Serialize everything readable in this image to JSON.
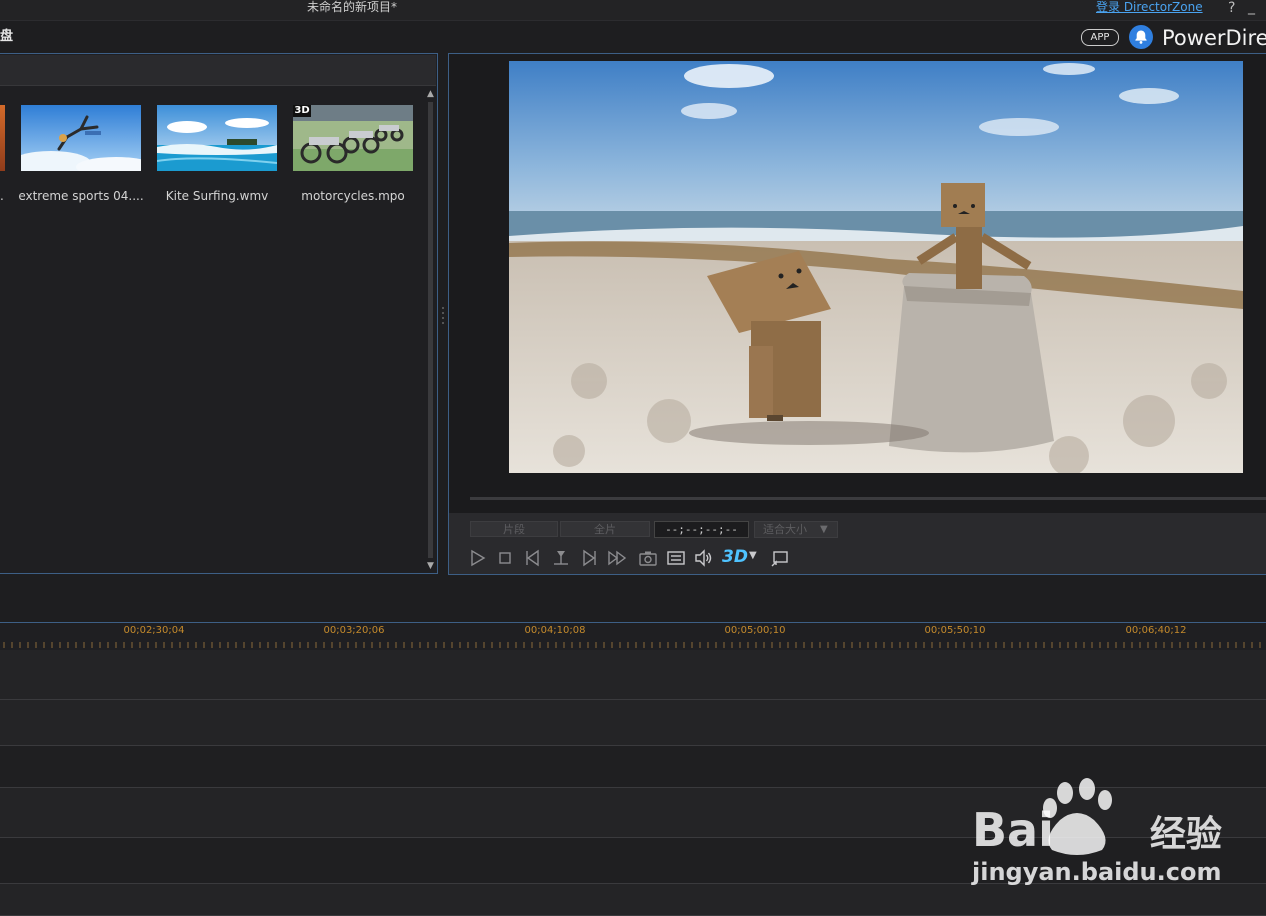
{
  "window": {
    "title": "未命名的新项目*",
    "login_link": "登录 DirectorZone",
    "help": "?",
    "minimize": "_"
  },
  "header": {
    "left_label": "盘",
    "app_badge": "APP",
    "brand": "PowerDirec"
  },
  "library": {
    "items": [
      {
        "label": "extreme sports 04....",
        "badge": ""
      },
      {
        "label": "Kite Surfing.wmv",
        "badge": ""
      },
      {
        "label": "motorcycles.mpo",
        "badge": "3D"
      }
    ],
    "partial_item_label": "."
  },
  "preview": {
    "mode_clip": "片段",
    "mode_movie": "全片",
    "timecode": "--;--;--;--",
    "fit_option": "适合大小",
    "stereo_label": "3D"
  },
  "timeline": {
    "ruler_labels": [
      "00;02;30;04",
      "00;03;20;06",
      "00;04;10;08",
      "00;05;00;10",
      "00;05;50;10",
      "00;06;40;12"
    ]
  },
  "watermark": {
    "brand": "Bai",
    "brand_cn": "经验",
    "url": "jingyan.baidu.com"
  },
  "colors": {
    "accent_border": "#3d5f86",
    "link": "#4aa3f0",
    "ruler_label": "#c48a2c"
  }
}
